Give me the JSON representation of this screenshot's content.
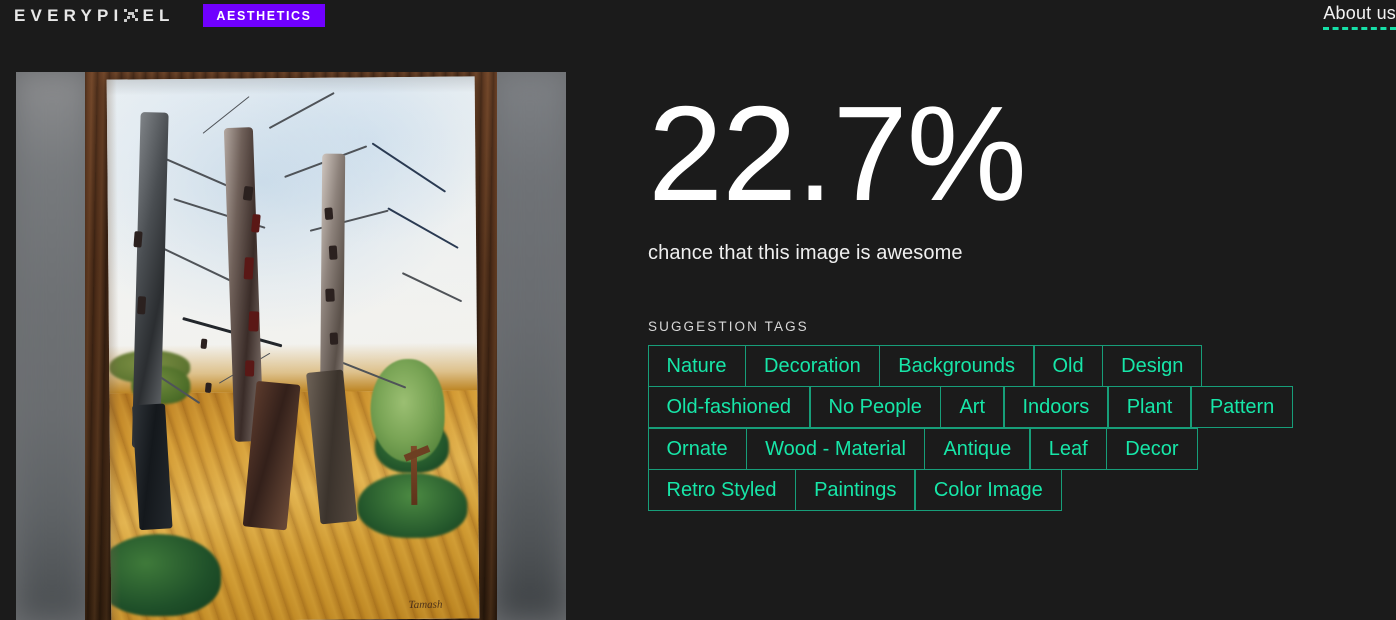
{
  "header": {
    "logo_part1": "EVERYPI",
    "logo_icon": "pixel-x-icon",
    "logo_part2": "EL",
    "badge_label": "AESTHETICS",
    "about_label": "About us"
  },
  "image_panel": {
    "alt": "watercolor painting of birch trees over a golden field, photographed on a wooden surface",
    "signature": "Tamash"
  },
  "result": {
    "score": "22.7%",
    "caption": "chance that this image is awesome"
  },
  "tags_section": {
    "label": "SUGGESTION TAGS",
    "tags": [
      "Nature",
      "Decoration",
      "Backgrounds",
      "Old",
      "Design",
      "Old-fashioned",
      "No People",
      "Art",
      "Indoors",
      "Plant",
      "Pattern",
      "Ornate",
      "Wood - Material",
      "Antique",
      "Leaf",
      "Decor",
      "Retro Styled",
      "Paintings",
      "Color Image"
    ]
  },
  "colors": {
    "background": "#1b1b1b",
    "accent_purple": "#7000ff",
    "accent_teal": "#17e6a8",
    "tag_border": "#179e79",
    "text_primary": "#ffffff"
  }
}
